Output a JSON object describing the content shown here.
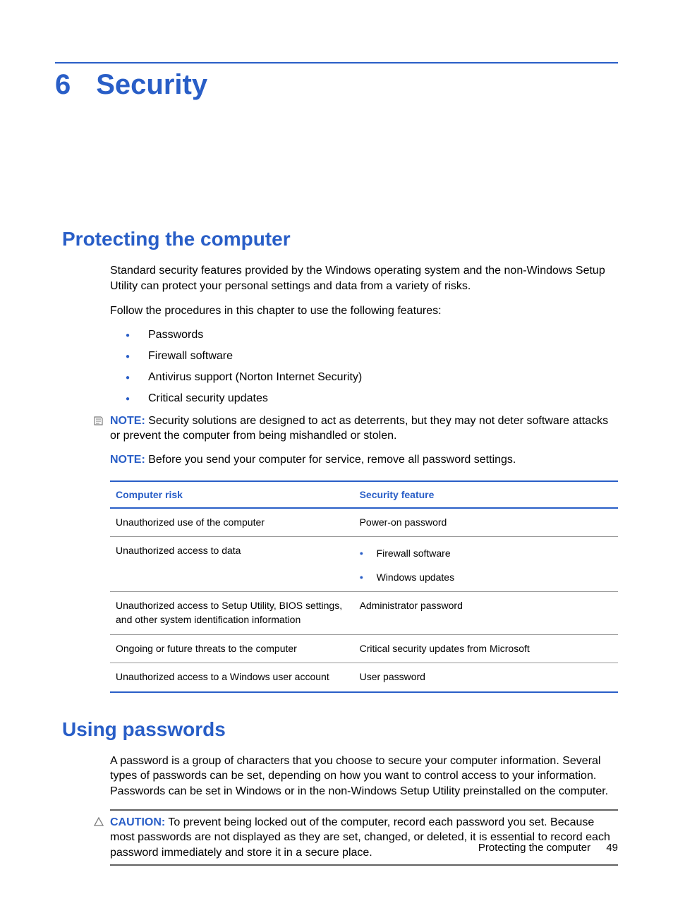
{
  "chapter": {
    "number": "6",
    "title": "Security"
  },
  "section1": {
    "heading": "Protecting the computer",
    "p1": "Standard security features provided by the Windows operating system and the non-Windows Setup Utility can protect your personal settings and data from a variety of risks.",
    "p2": "Follow the procedures in this chapter to use the following features:",
    "bullets": [
      "Passwords",
      "Firewall software",
      "Antivirus support (Norton Internet Security)",
      "Critical security updates"
    ],
    "note1_label": "NOTE:",
    "note1_text": "Security solutions are designed to act as deterrents, but they may not deter software attacks or prevent the computer from being mishandled or stolen.",
    "note2_label": "NOTE:",
    "note2_text": "Before you send your computer for service, remove all password settings.",
    "table": {
      "headers": [
        "Computer risk",
        "Security feature"
      ],
      "rows": [
        {
          "risk": "Unauthorized use of the computer",
          "feature_text": "Power-on password"
        },
        {
          "risk": "Unauthorized access to data",
          "feature_bullets": [
            "Firewall software",
            "Windows updates"
          ]
        },
        {
          "risk": "Unauthorized access to Setup Utility, BIOS settings, and other system identification information",
          "feature_text": "Administrator password"
        },
        {
          "risk": "Ongoing or future threats to the computer",
          "feature_text": "Critical security updates from Microsoft"
        },
        {
          "risk": "Unauthorized access to a Windows user account",
          "feature_text": "User password"
        }
      ]
    }
  },
  "section2": {
    "heading": "Using passwords",
    "p1": "A password is a group of characters that you choose to secure your computer information. Several types of passwords can be set, depending on how you want to control access to your information. Passwords can be set in Windows or in the non-Windows Setup Utility preinstalled on the computer.",
    "caution_label": "CAUTION:",
    "caution_text": "To prevent being locked out of the computer, record each password you set. Because most passwords are not displayed as they are set, changed, or deleted, it is essential to record each password immediately and store it in a secure place."
  },
  "footer": {
    "title": "Protecting the computer",
    "page": "49"
  }
}
